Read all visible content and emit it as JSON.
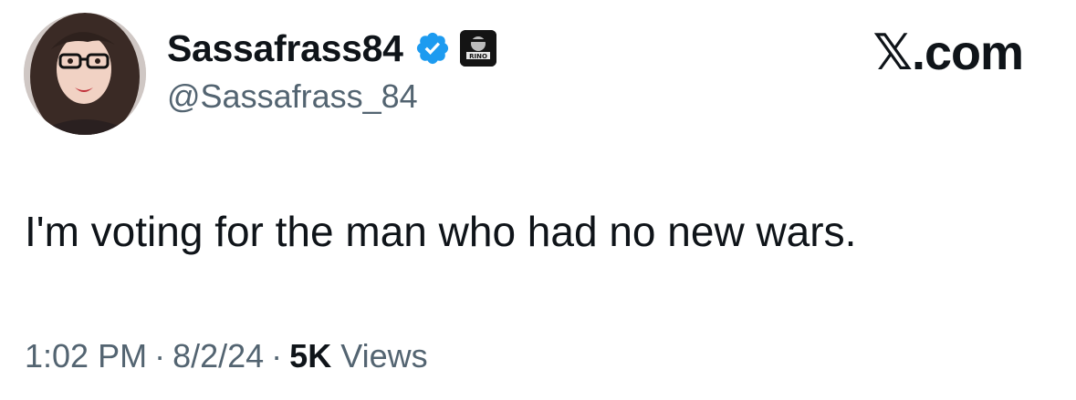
{
  "user": {
    "display_name": "Sassafrass84",
    "handle": "@Sassafrass_84",
    "affiliate_badge_text": "RINO"
  },
  "icons": {
    "verified": "verified-badge-icon",
    "affiliate": "affiliate-badge-icon",
    "avatar": "profile-avatar"
  },
  "site_label": "𝕏.com",
  "tweet": {
    "text": "I'm voting for the man who had no new wars.",
    "time": "1:02 PM",
    "separator": "·",
    "date": "8/2/24",
    "views_count": "5K",
    "views_label": "Views"
  },
  "colors": {
    "verified_blue": "#1d9bf0",
    "text_primary": "#0f1419",
    "text_secondary": "#536471"
  }
}
